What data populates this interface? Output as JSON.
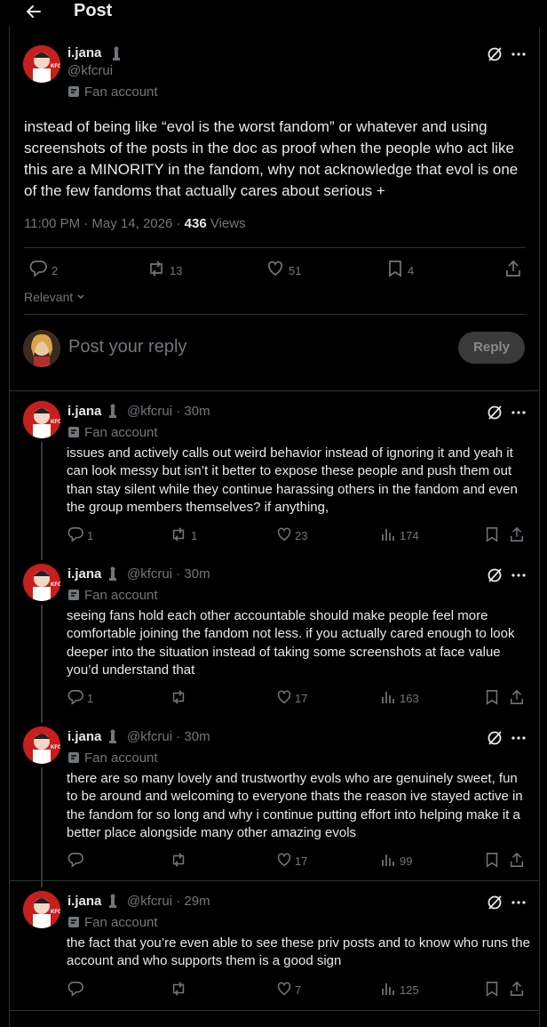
{
  "header": {
    "title": "Post"
  },
  "main_post": {
    "name": "i.jana",
    "handle": "@kfcrui",
    "label": "Fan account",
    "text": "instead of being like “evol is the worst fandom” or whatever and using screenshots of the posts in the doc as proof when the people who act like this are a MINORITY in the fandom, why not acknowledge that evol is one of the few fandoms that actually cares about serious +",
    "timestamp": "11:00 PM · May 14, 2026 ·",
    "views_count": "436",
    "views_label": "Views",
    "replies": "2",
    "reposts": "13",
    "likes": "51",
    "bookmarks": "4"
  },
  "sort": {
    "label": "Relevant"
  },
  "composer": {
    "placeholder": "Post your reply",
    "button": "Reply"
  },
  "replies": [
    {
      "name": "i.jana",
      "handle": "@kfcrui · 30m",
      "label": "Fan account",
      "text": "issues and actively calls out weird behavior instead of ignoring it and yeah it can look messy but isn’t it better to expose these people and push them out than stay silent while they continue harassing others in the fandom and even the group members themselves? if anything,",
      "replies": "1",
      "reposts": "1",
      "likes": "23",
      "views": "174"
    },
    {
      "name": "i.jana",
      "handle": "@kfcrui · 30m",
      "label": "Fan account",
      "text": "seeing fans hold each other accountable should make people feel more comfortable joining the fandom not less. if you actually cared enough to look deeper into the situation instead of taking some screenshots at face value you’d understand that",
      "replies": "1",
      "reposts": "",
      "likes": "17",
      "views": "163"
    },
    {
      "name": "i.jana",
      "handle": "@kfcrui · 30m",
      "label": "Fan account",
      "text": "there are so many lovely and trustworthy evols who are genuinely sweet, fun to be around and welcoming to everyone thats the reason ive stayed active in the fandom for so long and why i continue putting effort into helping make it a better place alongside many other amazing evols",
      "replies": "",
      "reposts": "",
      "likes": "17",
      "views": "99"
    },
    {
      "name": "i.jana",
      "handle": "@kfcrui · 29m",
      "label": "Fan account",
      "text": "the fact that you’re even able to see these priv posts and to know who runs the account and who supports them is a good sign",
      "replies": "",
      "reposts": "",
      "likes": "7",
      "views": "125"
    }
  ],
  "colors": {
    "background": "#000000",
    "text": "#e7e9ea",
    "muted": "#71767b",
    "divider": "#2f3336",
    "avatar": "#c81e1e"
  }
}
